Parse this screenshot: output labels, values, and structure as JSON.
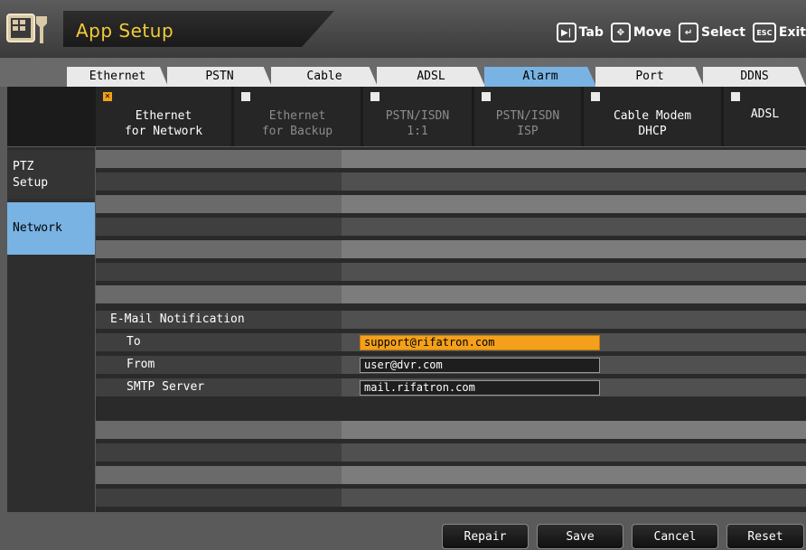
{
  "header": {
    "title": "App Setup",
    "hints": [
      {
        "key_icon": "tab-key-icon",
        "key": "▶|",
        "label": "Tab"
      },
      {
        "key_icon": "move-key-icon",
        "key": "✥",
        "label": "Move"
      },
      {
        "key_icon": "select-key-icon",
        "key": "↵",
        "label": "Select"
      },
      {
        "key_icon": "esc-key-icon",
        "key": "ESC",
        "label": "Exit"
      }
    ]
  },
  "tabs": [
    "Ethernet",
    "PSTN",
    "Cable",
    "ADSL",
    "Alarm",
    "Port",
    "DDNS"
  ],
  "active_tab": "Alarm",
  "options": [
    {
      "label": "Ethernet\nfor Network",
      "checked": true,
      "enabled": true
    },
    {
      "label": "Ethernet\nfor Backup",
      "checked": false,
      "enabled": false
    },
    {
      "label": "PSTN/ISDN\n1:1",
      "checked": false,
      "enabled": false
    },
    {
      "label": "PSTN/ISDN\nISP",
      "checked": false,
      "enabled": false
    },
    {
      "label": "Cable Modem\nDHCP",
      "checked": false,
      "enabled": true
    },
    {
      "label": "ADSL",
      "checked": false,
      "enabled": true
    }
  ],
  "nav": {
    "ptz": "PTZ\nSetup",
    "network": "Network"
  },
  "email": {
    "section_label": "E-Mail Notification",
    "to_label": "To",
    "to_value": "support@rifatron.com",
    "from_label": "From",
    "from_value": "user@dvr.com",
    "smtp_label": "SMTP Server",
    "smtp_value": "mail.rifatron.com"
  },
  "buttons": {
    "repair": "Repair",
    "save": "Save",
    "cancel": "Cancel",
    "reset": "Reset"
  },
  "colors": {
    "accent_blue": "#79b3e4",
    "focus_orange": "#f4a01a",
    "title_yellow": "#f2ca3a"
  }
}
